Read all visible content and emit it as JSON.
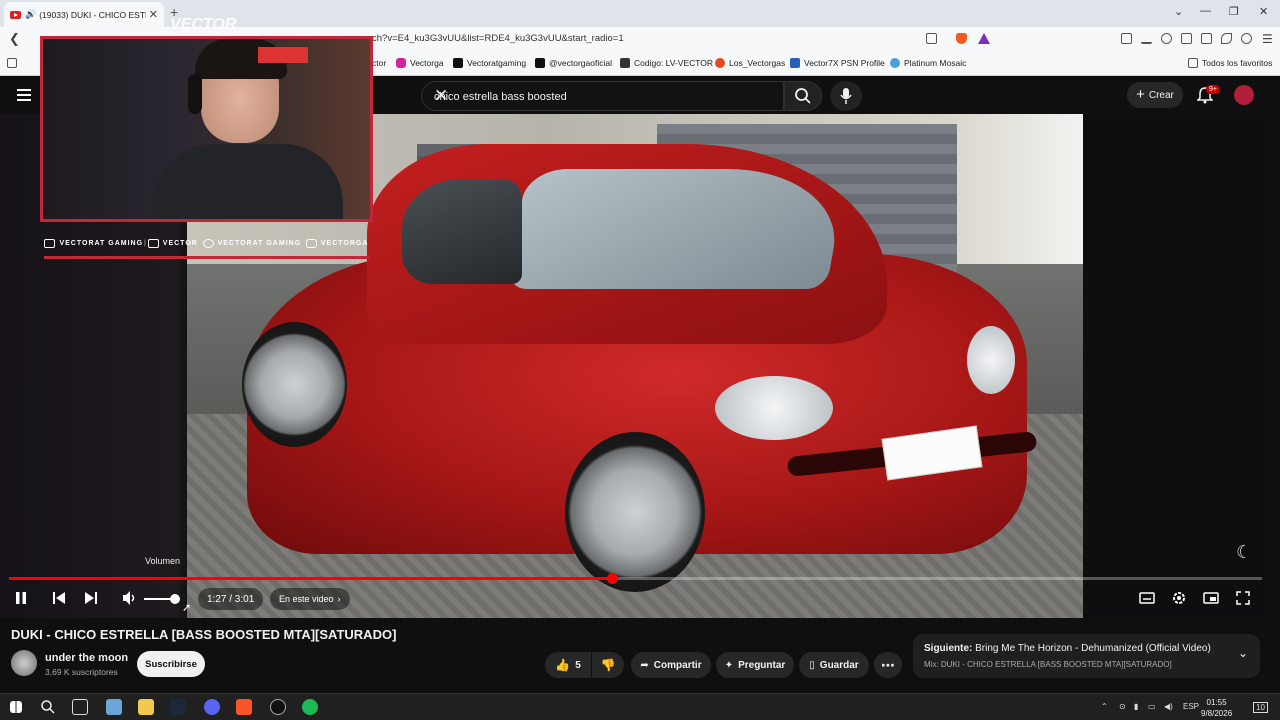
{
  "browser": {
    "tab_title": "(19033) DUKI - CHICO ESTRE",
    "url": "ch?v=E4_ku3G3vUU&list=RDE4_ku3G3vUU&start_radio=1",
    "bookmarks": [
      {
        "label": "ctor",
        "color": "#555"
      },
      {
        "label": "Vectorga",
        "color": "#d6249f"
      },
      {
        "label": "Vectoratgaming",
        "color": "#111"
      },
      {
        "label": "@vectorgaoficial",
        "color": "#111"
      },
      {
        "label": "Codigo: LV-VECTOR",
        "color": "#333"
      },
      {
        "label": "Los_Vectorgas",
        "color": "#e34a1f"
      },
      {
        "label": "Vector7X PSN Profile",
        "color": "#2b5fb5"
      },
      {
        "label": "Platinum Mosaic",
        "color": "#4aa0d8"
      }
    ],
    "all_favorites": "Todos los favoritos"
  },
  "youtube": {
    "search_query": "chico estrella bass boosted",
    "create_label": "Crear",
    "notif_badge": "9+"
  },
  "overlay": {
    "watermark": "VECTOR",
    "socials": [
      "VECTORAT GAMING",
      "VECTOR",
      "VECTORAT GAMING",
      "VECTORGA"
    ]
  },
  "player": {
    "volume_tooltip": "Volumen",
    "time": "1:27 / 3:01",
    "chapter": "En este video",
    "progress": 0.481
  },
  "video": {
    "title": "DUKI - CHICO ESTRELLA [BASS BOOSTED MTA][SATURADO]",
    "channel": "under the moon",
    "subscribers": "3,69 K suscriptores",
    "subscribe": "Suscribirse",
    "likes": "5",
    "share": "Compartir",
    "ask": "Preguntar",
    "save": "Guardar"
  },
  "next": {
    "label": "Siguiente:",
    "title": "Bring Me The Horizon - Dehumanized (Official Video)",
    "mix": "Mix: DUKI - CHICO ESTRELLA [BASS BOOSTED MTA][SATURADO]"
  },
  "taskbar": {
    "lang": "ESP",
    "time": "01:55",
    "date": "9/8/2026",
    "notif_count": "10"
  }
}
